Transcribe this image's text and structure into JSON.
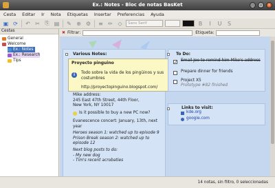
{
  "window": {
    "title": "Ex.: Notes - Bloc de notas BasKet"
  },
  "menu": [
    "Cesta",
    "Editar",
    "Ir",
    "Nota",
    "Etiquetas",
    "Insertar",
    "Preferencias",
    "Ayuda"
  ],
  "toolbar": {
    "font_combo": "Sans Serif",
    "size_combo": ""
  },
  "sidebar": {
    "header": "Cestas",
    "items": [
      {
        "label": "General",
        "color": "#e07b2a"
      },
      {
        "label": "Welcome",
        "color": "#d04a4a"
      },
      {
        "label": "Ex.: Notes",
        "color": "#4a8fd8"
      },
      {
        "label": "Ex.: Research",
        "color": "#9c5ad0"
      },
      {
        "label": "Tips",
        "color": "#f0c020"
      }
    ]
  },
  "filterbar": {
    "filter_label": "Filtrar:",
    "filter_value": "",
    "tag_label": "Etiqueta:",
    "tag_value": ""
  },
  "board": {
    "various_title": "Various Notes:",
    "tip": {
      "title": "Proyecto pinguino",
      "body": "Todo sobre la vida de los pingüinos y sus costumbres",
      "url": "http://proyectopinguino.blogspot.com/"
    },
    "address": [
      "Mike address:",
      "245 East 47th Street, 44th Floor,",
      "New York, NY 10017"
    ],
    "question": "Is it possible to buy a new PC now?",
    "concert": [
      "Evanescence concert: January, 13th, next",
      "year"
    ],
    "heroes": [
      "Heroes season 1: watched up to episode 9",
      "Prison Break season 2: watched up to",
      "episode 12"
    ],
    "blog": [
      "Next blog posts to do:",
      "- My new dog",
      "- Tim's recent acrobaties"
    ],
    "todo_title": "To Do:",
    "todos": [
      {
        "text": "Email Joe to remind him Mike's address",
        "done": true
      },
      {
        "text": "Prepare dinner for friends",
        "done": false
      },
      {
        "text": "Project X5",
        "done": false
      }
    ],
    "todo_sub": "Prototype #82 finished",
    "links_title": "Links to visit:",
    "links": [
      "kde.org",
      "google.com"
    ]
  },
  "status": {
    "text": "14 notas, sin filtro, 0 seleccionadas"
  }
}
